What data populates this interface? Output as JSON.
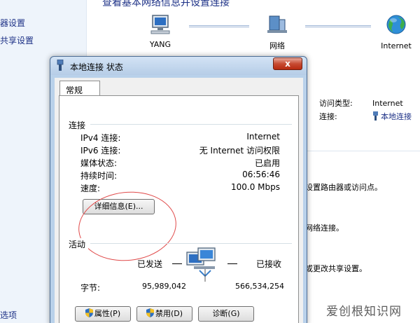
{
  "background": {
    "left_links": [
      "器设置",
      "共享设置",
      "选项"
    ],
    "title": "查看基本网络信息并设置连接",
    "network_nodes": [
      {
        "icon": "computer-icon",
        "label": "YANG"
      },
      {
        "icon": "network-icon",
        "label": "网络"
      },
      {
        "icon": "globe-icon",
        "label": "Internet"
      }
    ],
    "access_type_label": "访问类型:",
    "access_type_value": "Internet",
    "connection_label": "连接:",
    "connection_value": "本地连接",
    "text_1": "设置路由器或访问点。",
    "text_2": "网络连接。",
    "text_3": "或更改共享设置。"
  },
  "dialog": {
    "title": "本地连接 状态",
    "close_label": "x",
    "tab_label": "常规",
    "connection_group": "连接",
    "rows": [
      {
        "label": "IPv4 连接:",
        "value": "Internet"
      },
      {
        "label": "IPv6 连接:",
        "value": "无 Internet 访问权限"
      },
      {
        "label": "媒体状态:",
        "value": "已启用"
      },
      {
        "label": "持续时间:",
        "value": "06:56:46"
      },
      {
        "label": "速度:",
        "value": "100.0 Mbps"
      }
    ],
    "details_button": "详细信息(E)...",
    "activity_group": "活动",
    "sent_label": "已发送",
    "received_label": "已接收",
    "bytes_label": "字节:",
    "bytes_sent": "95,989,042",
    "bytes_received": "566,534,254",
    "properties_button": "属性(P)",
    "disable_button": "禁用(D)",
    "diagnose_button": "诊断(G)"
  },
  "watermark": "爱创根知识网",
  "colors": {
    "link": "#1e3287",
    "annotation_circle": "#e04a4a",
    "titlebar": "#b9d1ea"
  }
}
